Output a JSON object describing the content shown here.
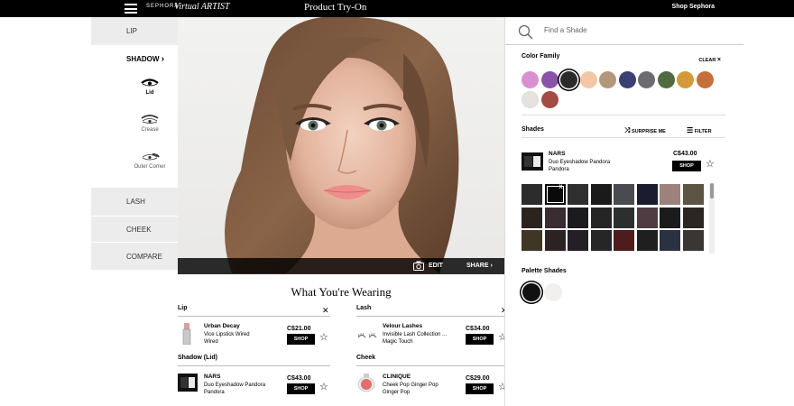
{
  "topbar": {
    "brand_small": "SEPHORA",
    "brand_script": "Virtual ARTIST",
    "title": "Product Try-On",
    "shop_link": "Shop Sephora"
  },
  "leftnav": {
    "lip": "LIP",
    "shadow": "SHADOW",
    "shadow_chevron": "›",
    "sub_lid": "Lid",
    "sub_crease": "Crease",
    "sub_outer": "Outer Corner",
    "lash": "LASH",
    "cheek": "CHEEK",
    "compare": "COMPARE"
  },
  "photo": {
    "edit": "EDIT",
    "share": "SHARE"
  },
  "rpanel": {
    "search_placeholder": "Find a Shade",
    "color_family": "Color Family",
    "clear": "CLEAR",
    "clear_icon": "×",
    "color_family_swatches": [
      "#d98fd0",
      "#8a52a8",
      "#2b2b2b",
      "#f3c7a4",
      "#b3967c",
      "#3c3f72",
      "#6a6c70",
      "#4f6b3f",
      "#d49a3a",
      "#c56f3b",
      "#e6e3de",
      "#a34c44"
    ],
    "color_family_selected": 2,
    "shades_title": "Shades",
    "surprise": "SURPRISE ME",
    "filter": "FILTER",
    "product": {
      "brand": "NARS",
      "name_line1": "Duo Eyeshadow Pandora",
      "name_line2": "Pandora",
      "price": "C$43.00",
      "shop": "SHOP"
    },
    "shade_grid": [
      [
        "#2c2c2c",
        "#0a0a0a",
        "#2f2f2f",
        "#1a1a1a",
        "#4a4b50",
        "#1b1c2e",
        "#9c827a",
        "#5e5444"
      ],
      [
        "#2a2420",
        "#3a2c30",
        "#1b1b1e",
        "#262525",
        "#2d2e2e",
        "#4e3c42",
        "#1c1b1b",
        "#2b2523"
      ],
      [
        "#3f3624",
        "#2c2224",
        "#241f24",
        "#262628",
        "#4e1c1c",
        "#1f1f1f",
        "#2a3242",
        "#3a3634"
      ]
    ],
    "shade_selected_mark": "X",
    "palette_title": "Palette Shades",
    "palette": [
      "#111111",
      "#f1f0ee"
    ]
  },
  "wearing": {
    "title": "What You're Wearing",
    "items": [
      {
        "category": "Lip",
        "brand": "Urban Decay",
        "line1": "Vice Lipstick Wired",
        "line2": "Wired",
        "price": "C$21.00",
        "shop": "SHOP"
      },
      {
        "category": "Lash",
        "brand": "Velour Lashes",
        "line1": "Invisible Lash Collection ...",
        "line2": "Magic Touch",
        "price": "C$34.00",
        "shop": "SHOP"
      },
      {
        "category": "Shadow (Lid)",
        "brand": "NARS",
        "line1": "Duo Eyeshadow Pandora",
        "line2": "Pandora",
        "price": "C$43.00",
        "shop": "SHOP"
      },
      {
        "category": "Cheek",
        "brand": "CLINIQUE",
        "line1": "Cheek Pop Ginger Pop",
        "line2": "Ginger Pop",
        "price": "C$29.00",
        "shop": "SHOP"
      }
    ]
  }
}
